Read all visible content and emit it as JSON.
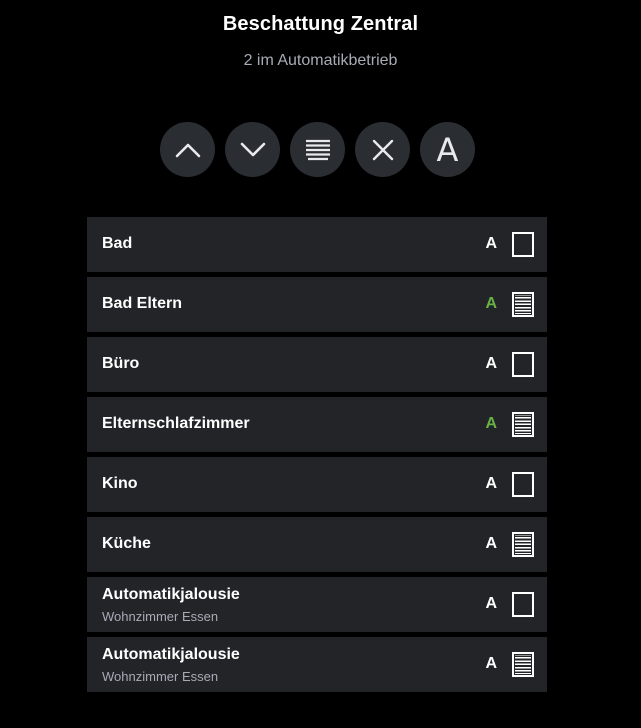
{
  "header": {
    "title": "Beschattung Zentral",
    "subtitle": "2 im Automatikbetrieb"
  },
  "controls": [
    {
      "name": "up",
      "icon": "chevron-up-icon"
    },
    {
      "name": "down",
      "icon": "chevron-down-icon"
    },
    {
      "name": "shade",
      "icon": "shade-icon"
    },
    {
      "name": "stop",
      "icon": "close-icon"
    },
    {
      "name": "auto",
      "label": "A"
    }
  ],
  "colors": {
    "background": "#000000",
    "row": "#222428",
    "button": "#2a2d32",
    "subtext": "#a6abb5",
    "auto_active": "#69b245"
  },
  "rows": [
    {
      "name": "Bad",
      "subtitle": "",
      "mode": "A",
      "auto_active": false,
      "blind_state": "open"
    },
    {
      "name": "Bad Eltern",
      "subtitle": "",
      "mode": "A",
      "auto_active": true,
      "blind_state": "closed"
    },
    {
      "name": "Büro",
      "subtitle": "",
      "mode": "A",
      "auto_active": false,
      "blind_state": "open"
    },
    {
      "name": "Elternschlafzimmer",
      "subtitle": "",
      "mode": "A",
      "auto_active": true,
      "blind_state": "closed"
    },
    {
      "name": "Kino",
      "subtitle": "",
      "mode": "A",
      "auto_active": false,
      "blind_state": "open"
    },
    {
      "name": "Küche",
      "subtitle": "",
      "mode": "A",
      "auto_active": false,
      "blind_state": "closed"
    },
    {
      "name": "Automatikjalousie",
      "subtitle": "Wohnzimmer Essen",
      "mode": "A",
      "auto_active": false,
      "blind_state": "open"
    },
    {
      "name": "Automatikjalousie",
      "subtitle": "Wohnzimmer Essen",
      "mode": "A",
      "auto_active": false,
      "blind_state": "closed"
    }
  ]
}
